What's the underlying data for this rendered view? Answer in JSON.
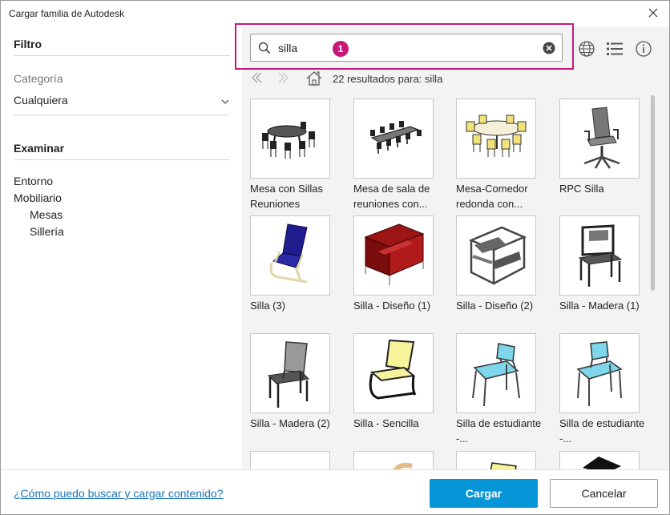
{
  "window": {
    "title": "Cargar familia de Autodesk"
  },
  "filter": {
    "heading": "Filtro",
    "category_label": "Categoría",
    "category_value": "Cualquiera"
  },
  "browse": {
    "heading": "Examinar",
    "items": [
      "Entorno",
      "Mobiliario",
      "Mesas",
      "Sillería"
    ]
  },
  "search": {
    "value": "silla",
    "callout_number": "1"
  },
  "results": {
    "text": "22 resultados para: silla"
  },
  "tiles": [
    {
      "caption": "Mesa con Sillas Reuniones",
      "icon": "meeting-table-chairs"
    },
    {
      "caption": "Mesa de sala de reuniones con...",
      "icon": "conference-table"
    },
    {
      "caption": "Mesa-Comedor redonda con...",
      "icon": "round-dining-table"
    },
    {
      "caption": "RPC Silla",
      "icon": "office-chair"
    },
    {
      "caption": "Silla (3)",
      "icon": "blue-lounge-chair"
    },
    {
      "caption": "Silla - Diseño (1)",
      "icon": "red-armchair"
    },
    {
      "caption": "Silla - Diseño (2)",
      "icon": "wassily-chair"
    },
    {
      "caption": "Silla - Madera (1)",
      "icon": "wood-chair-gray"
    },
    {
      "caption": "Silla - Madera (2)",
      "icon": "wood-chair-dark"
    },
    {
      "caption": "Silla - Sencilla",
      "icon": "yellow-cantilever-chair"
    },
    {
      "caption": "Silla de estudiante -...",
      "icon": "student-chair-cyan"
    },
    {
      "caption": "Silla de estudiante -...",
      "icon": "student-chair-cyan"
    },
    {
      "caption": "",
      "icon": "partial-tile"
    },
    {
      "caption": "",
      "icon": "partial-tile-tan"
    },
    {
      "caption": "",
      "icon": "partial-tile-yellow"
    },
    {
      "caption": "",
      "icon": "partial-tile-black"
    }
  ],
  "footer": {
    "help_link": "¿Cómo puedo buscar y cargar contenido?",
    "load_button": "Cargar",
    "cancel_button": "Cancelar"
  },
  "colors": {
    "accent": "#0696d7",
    "callout": "#c8197a",
    "link": "#1b74ba"
  }
}
